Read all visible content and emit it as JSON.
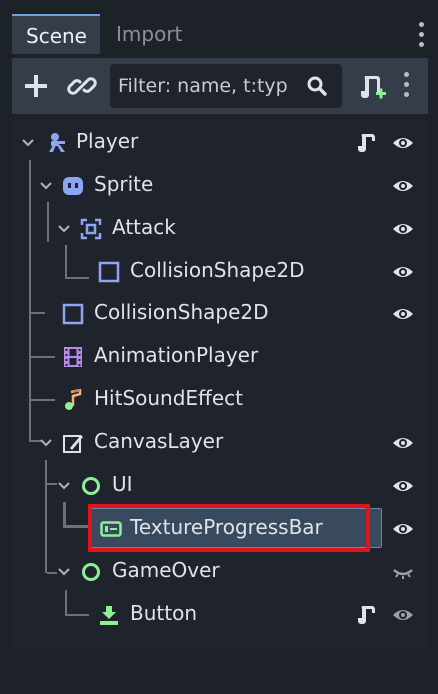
{
  "tabs": [
    {
      "label": "Scene",
      "active": true
    },
    {
      "label": "Import",
      "active": false
    }
  ],
  "toolbar": {
    "add_icon": "plus-icon",
    "link_icon": "link-icon",
    "filter_placeholder": "Filter: name, t:typ",
    "search_icon": "magnifier-icon",
    "attach_script_icon": "script-add-icon",
    "menu_icon": "vertical-dots-icon"
  },
  "tree": [
    {
      "label": "Player",
      "icon": "character-icon",
      "has_script": true,
      "visible": true
    },
    {
      "label": "Sprite",
      "icon": "sprite-face-icon",
      "visible": true
    },
    {
      "label": "Attack",
      "icon": "area-bracket-icon",
      "visible": true
    },
    {
      "label": "CollisionShape2D",
      "icon": "collision-square-icon",
      "visible": true
    },
    {
      "label": "CollisionShape2D",
      "icon": "collision-square-icon",
      "visible": true
    },
    {
      "label": "AnimationPlayer",
      "icon": "film-strip-icon"
    },
    {
      "label": "HitSoundEffect",
      "icon": "music-note-icon"
    },
    {
      "label": "CanvasLayer",
      "icon": "canvas-brush-icon",
      "visible": true
    },
    {
      "label": "UI",
      "icon": "control-circle-icon",
      "visible": true
    },
    {
      "label": "TextureProgressBar",
      "icon": "progress-bar-icon",
      "visible": true,
      "selected": true
    },
    {
      "label": "GameOver",
      "icon": "control-circle-icon",
      "visible": false
    },
    {
      "label": "Button",
      "icon": "button-icon",
      "has_script": true,
      "visible": true
    }
  ],
  "colors": {
    "accent": "#6f9fd8",
    "highlight": "#e0141e",
    "node2d_blue": "#8da5f3",
    "control_green": "#8eef97"
  }
}
